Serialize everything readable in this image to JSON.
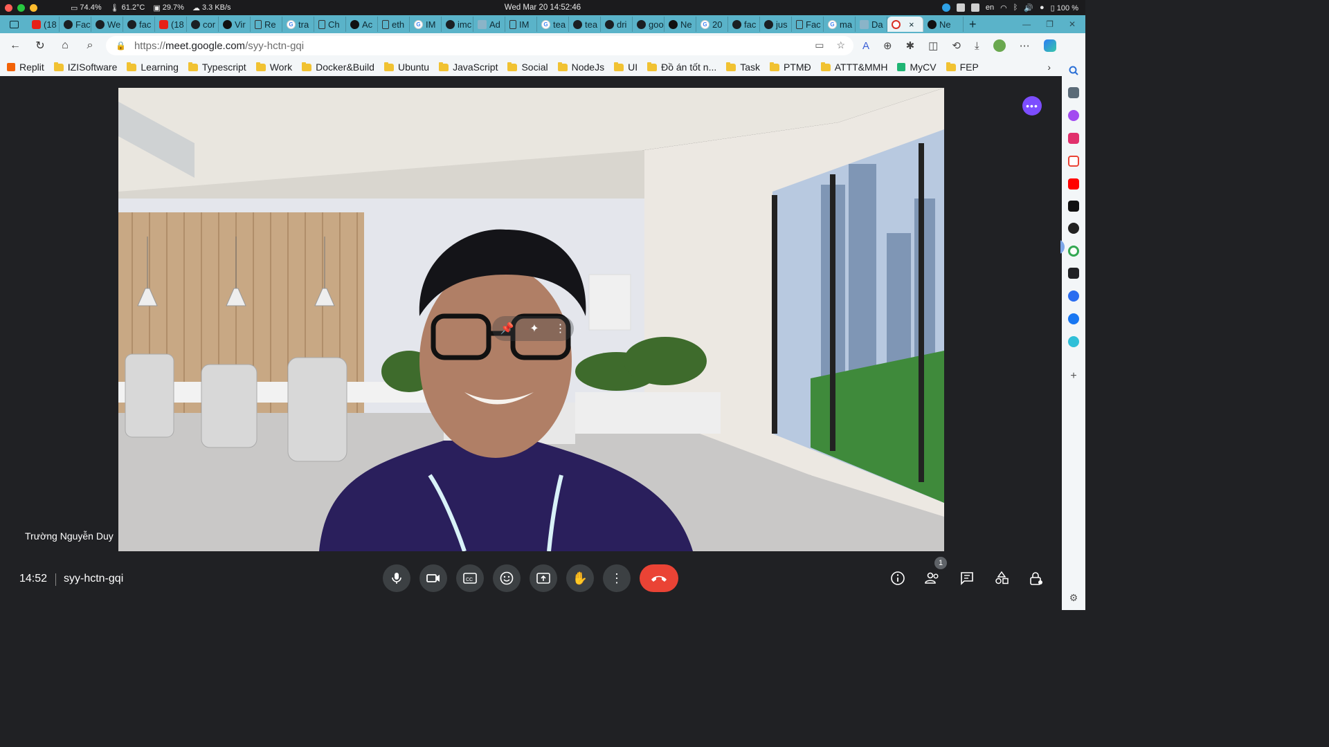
{
  "os": {
    "stats": [
      {
        "icon": "battery-icon",
        "value": "74.4%"
      },
      {
        "icon": "temperature-icon",
        "value": "61.2°C"
      },
      {
        "icon": "memory-icon",
        "value": "29.7%"
      },
      {
        "icon": "network-icon",
        "value": "3.3 KB/s"
      }
    ],
    "clock": "Wed Mar 20  14:52:46",
    "lang": "en",
    "battery": "100 %"
  },
  "tabs": [
    {
      "fav": "yt",
      "label": "(18"
    },
    {
      "fav": "gh",
      "label": "Fac"
    },
    {
      "fav": "gh",
      "label": "We"
    },
    {
      "fav": "gh",
      "label": "fac"
    },
    {
      "fav": "yt",
      "label": "(18"
    },
    {
      "fav": "gh",
      "label": "cor"
    },
    {
      "fav": "dark",
      "label": "Vir"
    },
    {
      "fav": "doc",
      "label": "Re"
    },
    {
      "fav": "g",
      "label": "tra"
    },
    {
      "fav": "doc",
      "label": "Ch"
    },
    {
      "fav": "dark",
      "label": "Ac"
    },
    {
      "fav": "doc",
      "label": "eth"
    },
    {
      "fav": "g",
      "label": "IM"
    },
    {
      "fav": "gh",
      "label": "imc"
    },
    {
      "fav": "ph",
      "label": "Ad"
    },
    {
      "fav": "doc",
      "label": "IM"
    },
    {
      "fav": "g",
      "label": "tea"
    },
    {
      "fav": "gh",
      "label": "tea"
    },
    {
      "fav": "gh",
      "label": "dri"
    },
    {
      "fav": "gh",
      "label": "goo"
    },
    {
      "fav": "dark",
      "label": "Ne"
    },
    {
      "fav": "g",
      "label": "20"
    },
    {
      "fav": "gh",
      "label": "fac"
    },
    {
      "fav": "gh",
      "label": "jus"
    },
    {
      "fav": "doc",
      "label": "Fac"
    },
    {
      "fav": "g",
      "label": "ma"
    },
    {
      "fav": "ph",
      "label": "Da"
    },
    {
      "fav": "rec",
      "label": "",
      "active": true,
      "close": "×"
    },
    {
      "fav": "dark",
      "label": "Ne"
    }
  ],
  "address": {
    "scheme": "https://",
    "host": "meet.google.com",
    "path": "/syy-hctn-gqi"
  },
  "bookmarks": [
    {
      "label": "Replit",
      "icon": "replit-icon"
    },
    {
      "label": "IZISoftware",
      "icon": "folder-icon"
    },
    {
      "label": "Learning",
      "icon": "folder-icon"
    },
    {
      "label": "Typescript",
      "icon": "folder-icon"
    },
    {
      "label": "Work",
      "icon": "folder-icon"
    },
    {
      "label": "Docker&Build",
      "icon": "folder-icon"
    },
    {
      "label": "Ubuntu",
      "icon": "folder-icon"
    },
    {
      "label": "JavaScript",
      "icon": "folder-icon"
    },
    {
      "label": "Social",
      "icon": "folder-icon"
    },
    {
      "label": "NodeJs",
      "icon": "folder-icon"
    },
    {
      "label": "UI",
      "icon": "folder-icon"
    },
    {
      "label": "Đồ án tốt n...",
      "icon": "folder-icon"
    },
    {
      "label": "Task",
      "icon": "folder-icon"
    },
    {
      "label": "PTMĐ",
      "icon": "folder-icon"
    },
    {
      "label": "ATTT&MMH",
      "icon": "folder-icon"
    },
    {
      "label": "MyCV",
      "icon": "mycv-icon"
    },
    {
      "label": "FEP",
      "icon": "folder-icon"
    }
  ],
  "meet": {
    "participant": "Trường Nguyễn Duy",
    "time": "14:52",
    "code": "syy-hctn-gqi",
    "people_count": "1",
    "more_fab": "•••"
  }
}
